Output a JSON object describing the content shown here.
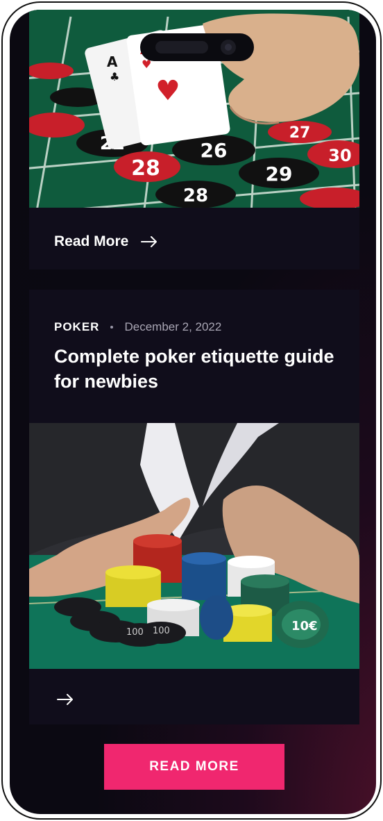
{
  "cards": [
    {
      "image_alt": "roulette-table-with-cards",
      "read_more_label": "Read More",
      "arrow_icon": "arrow-right-icon"
    },
    {
      "category": "POKER",
      "date": "December 2, 2022",
      "title": "Complete poker etiquette guide for newbies",
      "image_alt": "poker-chips-pushed-all-in",
      "arrow_icon": "arrow-right-icon"
    }
  ],
  "cta": {
    "label": "READ MORE"
  },
  "colors": {
    "card_bg": "#100d1b",
    "cta_bg": "#f0276f",
    "text": "#ffffff",
    "muted": "#a9a6b4"
  }
}
